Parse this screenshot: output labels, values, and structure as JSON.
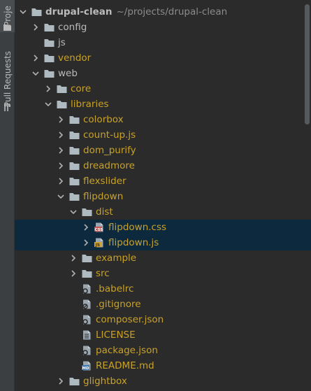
{
  "toolwindows": {
    "project_label": "Proje",
    "pull_requests_label": "Pull Requests"
  },
  "tree": {
    "rows": [
      {
        "label": "drupal-clean",
        "path": "~/projects/drupal-clean",
        "depth": 0,
        "type": "folder",
        "expanded": true,
        "style": "root"
      },
      {
        "label": "config",
        "depth": 1,
        "type": "folder",
        "expanded": false,
        "style": "folder"
      },
      {
        "label": "js",
        "depth": 1,
        "type": "folder",
        "leaf": true,
        "style": "folder"
      },
      {
        "label": "vendor",
        "depth": 1,
        "type": "folder",
        "expanded": false,
        "style": "lib"
      },
      {
        "label": "web",
        "depth": 1,
        "type": "folder",
        "expanded": true,
        "style": "folder"
      },
      {
        "label": "core",
        "depth": 2,
        "type": "folder",
        "expanded": false,
        "style": "lib"
      },
      {
        "label": "libraries",
        "depth": 2,
        "type": "folder",
        "expanded": true,
        "style": "lib"
      },
      {
        "label": "colorbox",
        "depth": 3,
        "type": "folder",
        "expanded": false,
        "style": "lib"
      },
      {
        "label": "count-up.js",
        "depth": 3,
        "type": "folder",
        "expanded": false,
        "style": "lib"
      },
      {
        "label": "dom_purify",
        "depth": 3,
        "type": "folder",
        "expanded": false,
        "style": "lib"
      },
      {
        "label": "dreadmore",
        "depth": 3,
        "type": "folder",
        "expanded": false,
        "style": "lib"
      },
      {
        "label": "flexslider",
        "depth": 3,
        "type": "folder",
        "expanded": false,
        "style": "lib"
      },
      {
        "label": "flipdown",
        "depth": 3,
        "type": "folder",
        "expanded": true,
        "style": "lib"
      },
      {
        "label": "dist",
        "depth": 4,
        "type": "folder",
        "expanded": true,
        "style": "lib"
      },
      {
        "label": "flipdown.css",
        "depth": 5,
        "type": "css",
        "expanded": false,
        "style": "lib",
        "selected": true
      },
      {
        "label": "flipdown.js",
        "depth": 5,
        "type": "js",
        "expanded": false,
        "style": "lib",
        "selected": true
      },
      {
        "label": "example",
        "depth": 4,
        "type": "folder",
        "expanded": false,
        "style": "lib"
      },
      {
        "label": "src",
        "depth": 4,
        "type": "folder",
        "expanded": false,
        "style": "lib"
      },
      {
        "label": ".babelrc",
        "depth": 4,
        "type": "config",
        "leaf": true,
        "style": "lib"
      },
      {
        "label": ".gitignore",
        "depth": 4,
        "type": "gitignore",
        "leaf": true,
        "style": "lib"
      },
      {
        "label": "composer.json",
        "depth": 4,
        "type": "json",
        "leaf": true,
        "style": "lib"
      },
      {
        "label": "LICENSE",
        "depth": 4,
        "type": "text",
        "leaf": true,
        "style": "lib"
      },
      {
        "label": "package.json",
        "depth": 4,
        "type": "json",
        "leaf": true,
        "style": "lib"
      },
      {
        "label": "README.md",
        "depth": 4,
        "type": "md",
        "leaf": true,
        "style": "lib"
      },
      {
        "label": "glightbox",
        "depth": 3,
        "type": "folder",
        "expanded": false,
        "style": "lib"
      }
    ]
  },
  "colors": {
    "background": "#2b2b2b",
    "selection": "#0d293e",
    "folder_icon": "#aeb9c0",
    "library_text": "#c9a227",
    "css_badge": "#c75450",
    "js_badge": "#d6a52f",
    "md_badge": "#3c76b5"
  }
}
